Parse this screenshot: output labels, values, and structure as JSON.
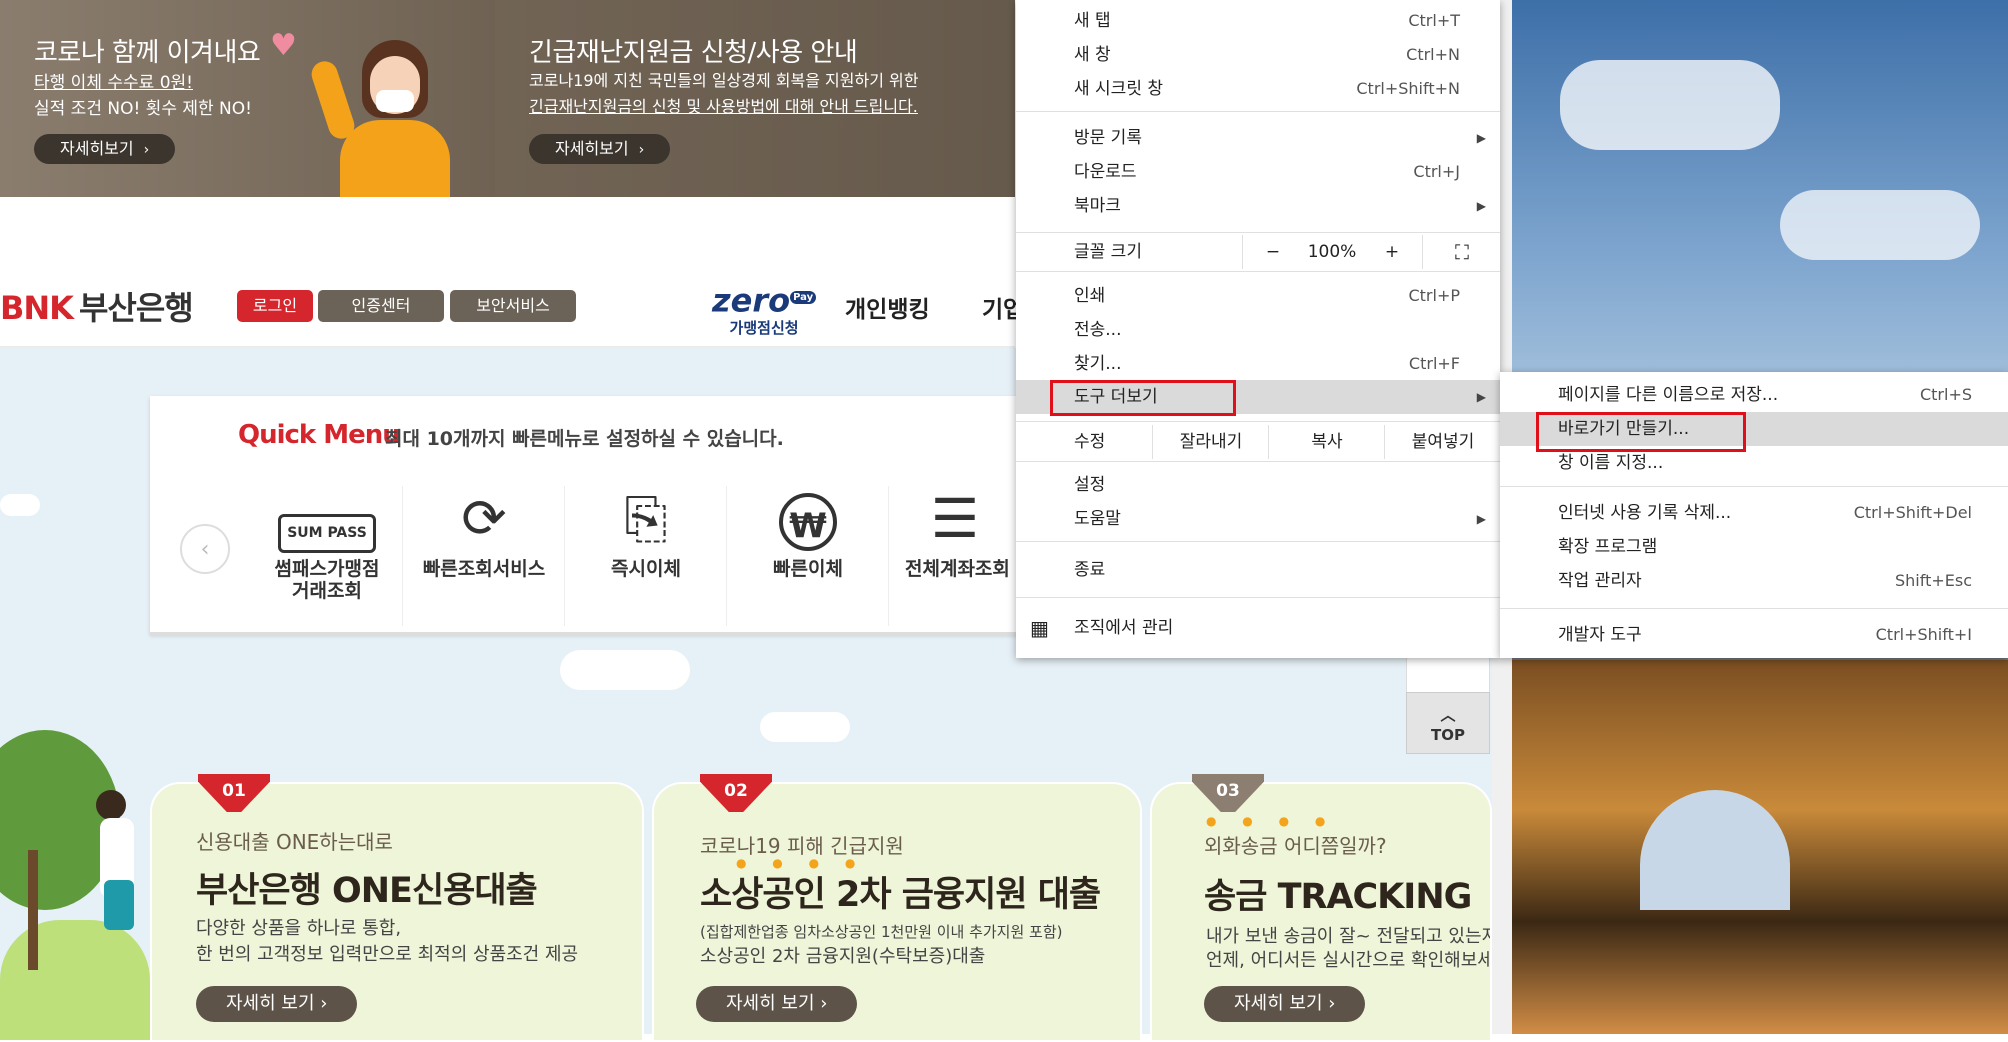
{
  "banners": [
    {
      "title": "코로나 함께 이겨내요",
      "lines": [
        "타행 이체 수수료 0원!",
        "실적 조건 NO! 횟수 제한 NO!"
      ],
      "button": "자세히보기"
    },
    {
      "title": "긴급재난지원금 신청/사용 안내",
      "lines": [
        "코로나19에 지친 국민들의 일상경제 회복을 지원하기 위한",
        "긴급재난지원금의 신청 및 사용방법에 대해 안내 드립니다."
      ],
      "button": "자세히보기"
    }
  ],
  "header": {
    "logo_mark": "BNK",
    "logo_name": "부산은행",
    "login": "로그인",
    "cert_center": "인증센터",
    "security": "보안서비스",
    "zero_big": "zero",
    "zero_badge": "Pay",
    "zero_small": "가맹점신청",
    "nav": [
      "개인뱅킹",
      "기업"
    ]
  },
  "quick_menu": {
    "title": "Quick Menu",
    "desc": "최대 10개까지 빠른메뉴로 설정하실 수 있습니다.",
    "items": [
      {
        "icon": "SUM PASS",
        "label": "썸패스가맹점\n거래조회"
      },
      {
        "icon": "⟳",
        "label": "빠른조회서비스"
      },
      {
        "icon": "⎘",
        "label": "즉시이체"
      },
      {
        "icon": "₩",
        "label": "빠른이체"
      },
      {
        "icon": "☰",
        "label": "전체계좌조회"
      }
    ]
  },
  "cards": [
    {
      "tag": "01",
      "sub": "신용대출 ONE하는대로",
      "title": "부산은행 ONE신용대출",
      "desc": [
        "다양한 상품을 하나로 통합,",
        "한 번의 고객정보 입력만으로 최적의 상품조건 제공"
      ],
      "button": "자세히 보기"
    },
    {
      "tag": "02",
      "sub": "코로나19 피해 긴급지원",
      "title": "소상공인 2차 금융지원 대출",
      "desc_small": "(집합제한업종 임차소상공인 1천만원 이내 추가지원 포함)",
      "desc": [
        "소상공인 2차 금융지원(수탁보증)대출"
      ],
      "button": "자세히 보기"
    },
    {
      "tag": "03",
      "sub": "외화송금 어디쯤일까?",
      "title": "송금 TRACKING",
      "desc": [
        "내가 보낸 송금이 잘~ 전달되고 있는지",
        "언제, 어디서든 실시간으로 확인해보세요"
      ],
      "button": "자세히 보기"
    }
  ],
  "top_button": "TOP",
  "main_menu": {
    "items": [
      {
        "label": "새 탭",
        "shortcut": "Ctrl+T"
      },
      {
        "label": "새 창",
        "shortcut": "Ctrl+N"
      },
      {
        "label": "새 시크릿 창",
        "shortcut": "Ctrl+Shift+N"
      },
      {
        "label": "방문 기록",
        "shortcut": ""
      },
      {
        "label": "다운로드",
        "shortcut": "Ctrl+J"
      },
      {
        "label": "북마크",
        "shortcut": ""
      },
      {
        "label": "글꼴 크기",
        "shortcut": ""
      },
      {
        "label": "인쇄",
        "shortcut": "Ctrl+P"
      },
      {
        "label": "전송...",
        "shortcut": ""
      },
      {
        "label": "찾기...",
        "shortcut": "Ctrl+F"
      },
      {
        "label": "도구 더보기",
        "shortcut": ""
      },
      {
        "label": "수정",
        "shortcut": ""
      },
      {
        "label": "설정",
        "shortcut": ""
      },
      {
        "label": "도움말",
        "shortcut": ""
      },
      {
        "label": "종료",
        "shortcut": ""
      },
      {
        "label": "조직에서 관리",
        "shortcut": ""
      }
    ],
    "zoom": {
      "minus": "−",
      "value": "100%",
      "plus": "+"
    },
    "edit": {
      "cut": "잘라내기",
      "copy": "복사",
      "paste": "붙여넣기"
    }
  },
  "sub_menu": {
    "items": [
      {
        "label": "페이지를 다른 이름으로 저장...",
        "shortcut": "Ctrl+S"
      },
      {
        "label": "바로가기 만들기...",
        "shortcut": ""
      },
      {
        "label": "창 이름 지정...",
        "shortcut": ""
      },
      {
        "label": "인터넷 사용 기록 삭제...",
        "shortcut": "Ctrl+Shift+Del"
      },
      {
        "label": "확장 프로그램",
        "shortcut": ""
      },
      {
        "label": "작업 관리자",
        "shortcut": "Shift+Esc"
      },
      {
        "label": "개발자 도구",
        "shortcut": "Ctrl+Shift+I"
      }
    ]
  },
  "colors": {
    "brand_red": "#d4262c",
    "highlight_box": "#e0101a"
  }
}
